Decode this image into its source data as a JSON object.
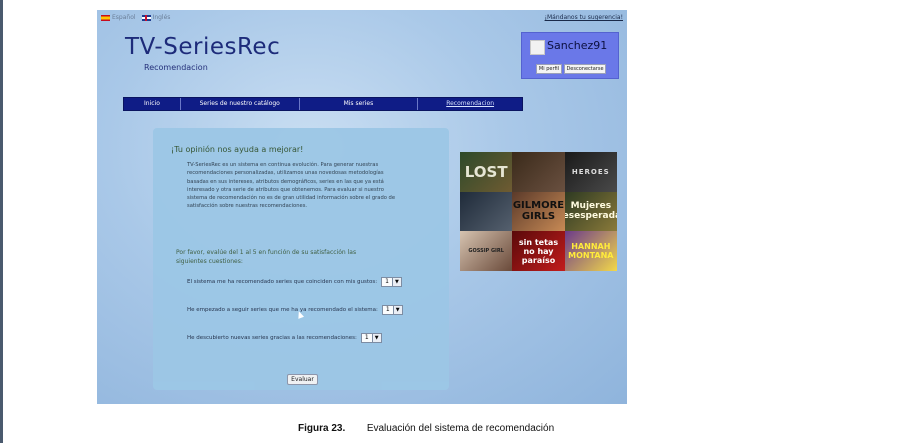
{
  "lang": {
    "spanish": "Español",
    "english": "Inglés"
  },
  "top_link": "¡Mándanos tu sugerencia!",
  "app": {
    "title": "TV-SeriesRec",
    "subtitle": "Recomendacion"
  },
  "user": {
    "name": "Sanchez91",
    "profile_button": "Mi perfil",
    "logout_button": "Desconectarse"
  },
  "nav": [
    {
      "label": "Inicio",
      "active": false
    },
    {
      "label": "Series de nuestro catálogo",
      "active": false
    },
    {
      "label": "Mis series",
      "active": false
    },
    {
      "label": "Recomendacion",
      "active": true
    }
  ],
  "form": {
    "title": "¡Tu opinión nos ayuda a mejorar!",
    "intro": "TV-SeriesRec es un sistema en continua evolución. Para generar nuestras recomendaciones personalizadas, utilizamos unas novedosas metodologías basadas en sus intereses, atributos demográficos, series en las que ya está interesado y otra serie de atributos que obtenemos. Para evaluar si nuestro sistema de recomendación no es de gran utilidad información sobre el grado de satisfacción sobre nuestras recomendaciones.",
    "prompt": "Por favor, evalúe del 1 al 5 en función de su satisfacción las siguientes cuestiones:",
    "questions": [
      {
        "text": "El sistema me ha recomendado series que coinciden con mis gustos:",
        "value": "1"
      },
      {
        "text": "He empezado a seguir series que me ha ya recomendado el sistema:",
        "value": "1"
      },
      {
        "text": "He descubierto nuevas series gracias a las recomendaciones:",
        "value": "1"
      }
    ],
    "submit": "Evaluar"
  },
  "collage": {
    "tiles": [
      "LOST",
      "",
      "HEROES",
      "",
      "GILMORE GIRLS",
      "Mujeres Desesperadas",
      "GOSSIP GIRL",
      "sin tetas no hay paraíso",
      "HANNAH MONTANA"
    ]
  },
  "caption": {
    "label": "Figura 23.",
    "text": "Evaluación del sistema de recomendación"
  }
}
